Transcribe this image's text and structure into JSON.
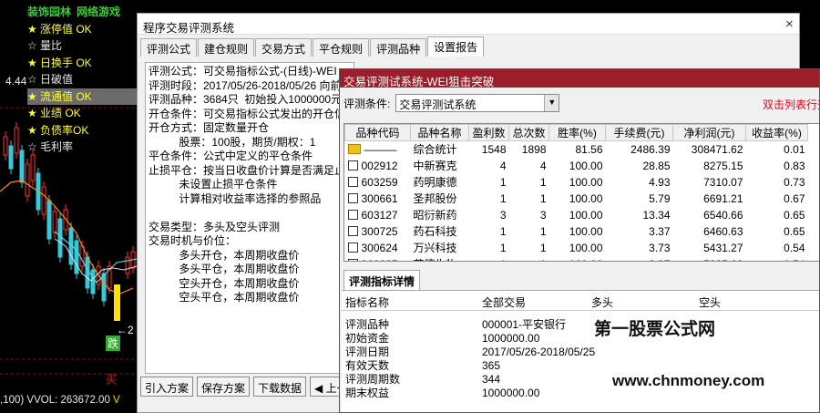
{
  "background": {
    "menu_tabs": [
      "装饰园林",
      "网络游戏"
    ],
    "menu_items": [
      {
        "star": "★",
        "label": "涨停值 OK",
        "color": "yellow",
        "highlight": false
      },
      {
        "star": "☆",
        "label": "量比",
        "color": "white",
        "highlight": false
      },
      {
        "star": "★",
        "label": "日换手 OK",
        "color": "yellow",
        "highlight": false
      },
      {
        "star": "☆",
        "label": "日破值",
        "color": "white",
        "highlight": false
      },
      {
        "star": "★",
        "label": "流通值 OK",
        "color": "yellow",
        "highlight": true
      },
      {
        "star": "★",
        "label": "业绩 OK",
        "color": "yellow",
        "highlight": false
      },
      {
        "star": "★",
        "label": "负债率OK",
        "color": "yellow",
        "highlight": false
      },
      {
        "star": "☆",
        "label": "毛利率",
        "color": "white",
        "highlight": false
      }
    ],
    "price_label": "4.44",
    "arrow_label": "←2",
    "die_label": "跌",
    "bottom_status": ",100) VVOL: 263672.00",
    "bottom_mark": "V"
  },
  "main_dialog": {
    "title": "程序交易评测系统",
    "close_label": "×",
    "tabs": [
      "评测公式",
      "建仓规则",
      "交易方式",
      "平仓规则",
      "评测品种",
      "设置报告"
    ],
    "active_tab": 5,
    "report_lines": [
      "评测公式：可交易指标公式-(日线)-WEI",
      "评测时段：2017/05/26-2018/05/26 向前",
      "评测品种：3684只  初始投入1000000元",
      "开仓条件：可交易指标公式发出的开仓信",
      "开仓方式：固定数量开仓",
      "          股票：100股，期货/期权：1",
      "平仓条件：公式中定义的平仓条件",
      "止损平仓：按当日收盘价计算是否满足止",
      "          未设置止损平仓条件",
      "          计算相对收益率选择的参照品",
      "",
      "交易类型：多头及空头评测",
      "交易时机与价位：",
      "          多头开仓，本周期收盘价",
      "          多头平仓，本周期收盘价",
      "          空头开仓，本周期收盘价",
      "          空头平仓，本周期收盘价"
    ],
    "buttons": [
      "引入方案",
      "保存方案",
      "下载数据",
      "◀ 上一"
    ]
  },
  "test_dialog": {
    "title": "交易评测试系统-WEI狙击突破",
    "condition_label": "评测条件:",
    "condition_value": "交易评测试系统",
    "hint": "双击列表行查",
    "columns": [
      "品种代码",
      "品种名称",
      "盈利数",
      "总次数",
      "胜率(%)",
      "手续费(元)",
      "净利润(元)",
      "收益率(%)"
    ],
    "rows": [
      {
        "icon": "folder",
        "code": "———",
        "name": "综合统计",
        "wins": "1548",
        "total": "1898",
        "rate": "81.56",
        "fee": "2486.39",
        "profit": "308471.62",
        "yield": "0.01"
      },
      {
        "icon": "box",
        "code": "002912",
        "name": "中新赛克",
        "wins": "4",
        "total": "4",
        "rate": "100.00",
        "fee": "28.85",
        "profit": "8275.15",
        "yield": "0.83"
      },
      {
        "icon": "box",
        "code": "603259",
        "name": "药明康德",
        "wins": "1",
        "total": "1",
        "rate": "100.00",
        "fee": "4.93",
        "profit": "7310.07",
        "yield": "0.73"
      },
      {
        "icon": "box",
        "code": "300661",
        "name": "圣邦股份",
        "wins": "1",
        "total": "1",
        "rate": "100.00",
        "fee": "5.79",
        "profit": "6691.21",
        "yield": "0.67"
      },
      {
        "icon": "box",
        "code": "603127",
        "name": "昭衍新药",
        "wins": "3",
        "total": "3",
        "rate": "100.00",
        "fee": "13.34",
        "profit": "6540.66",
        "yield": "0.65"
      },
      {
        "icon": "box",
        "code": "300725",
        "name": "药石科技",
        "wins": "1",
        "total": "1",
        "rate": "100.00",
        "fee": "3.37",
        "profit": "6460.63",
        "yield": "0.65"
      },
      {
        "icon": "box",
        "code": "300624",
        "name": "万兴科技",
        "wins": "1",
        "total": "1",
        "rate": "100.00",
        "fee": "3.73",
        "profit": "5431.27",
        "yield": "0.54"
      },
      {
        "icon": "box",
        "code": "300685",
        "name": "艾德生物",
        "wins": "1",
        "total": "1",
        "rate": "100.00",
        "fee": "3.37",
        "profit": "5385.63",
        "yield": "0.54"
      }
    ],
    "detail_tab": "评测指标详情",
    "detail_headers": [
      "指标名称",
      "全部交易",
      "多头",
      "空头"
    ],
    "detail_rows": [
      {
        "name": "评测品种",
        "value": "000001-平安银行"
      },
      {
        "name": "初始资金",
        "value": "1000000.00"
      },
      {
        "name": "评测日期",
        "value": "2017/05/26-2018/05/25"
      },
      {
        "name": "有效天数",
        "value": "365"
      },
      {
        "name": "评测周期数",
        "value": "344"
      },
      {
        "name": "期末权益",
        "value": "1000000.00"
      }
    ]
  },
  "watermark": {
    "line1": "第一股票公式网",
    "line2": "www.chnmoney.com"
  },
  "colors": {
    "test_title_bg": "#9b1e2a",
    "hint_red": "#e8001c",
    "menu_green": "#3ac93a",
    "menu_yellow": "#ffff33"
  }
}
